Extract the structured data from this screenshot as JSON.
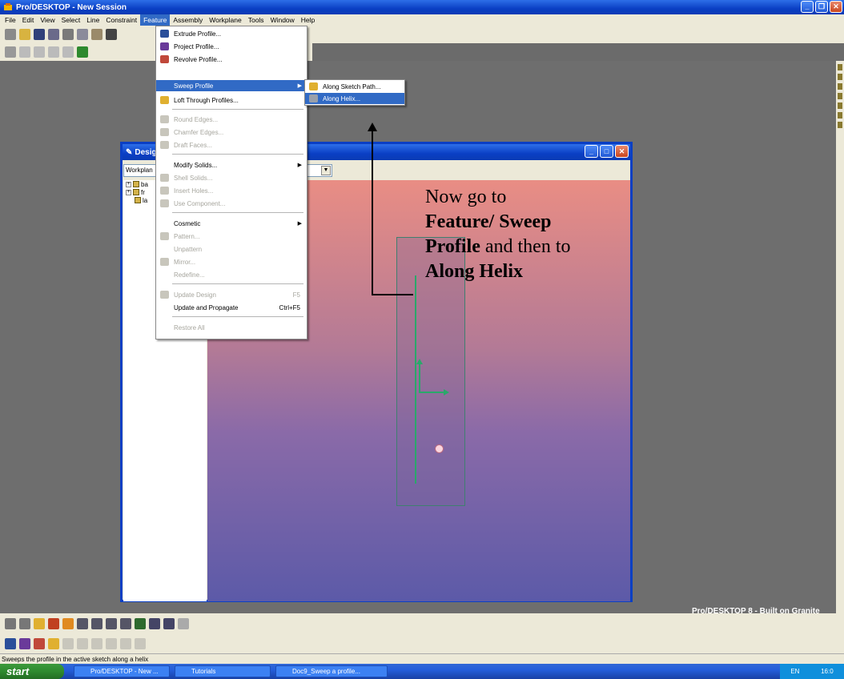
{
  "window": {
    "title": "Pro/DESKTOP - New Session"
  },
  "menubar": [
    "File",
    "Edit",
    "View",
    "Select",
    "Line",
    "Constraint",
    "Feature",
    "Assembly",
    "Workplane",
    "Tools",
    "Window",
    "Help"
  ],
  "feature_menu": {
    "items": [
      {
        "label": "Extrude Profile...",
        "enabled": true
      },
      {
        "label": "Project Profile...",
        "enabled": true
      },
      {
        "label": "Revolve Profile...",
        "enabled": true
      },
      {
        "label": "Sweep Profile",
        "enabled": true,
        "submenu": true,
        "highlighted": true
      },
      {
        "label": "Loft Through Profiles...",
        "enabled": true
      },
      {
        "label": "Round Edges...",
        "enabled": false
      },
      {
        "label": "Chamfer Edges...",
        "enabled": false
      },
      {
        "label": "Draft Faces...",
        "enabled": false
      },
      {
        "label": "Modify Solids...",
        "enabled": true,
        "submenu": true
      },
      {
        "label": "Shell Solids...",
        "enabled": false
      },
      {
        "label": "Insert Holes...",
        "enabled": false
      },
      {
        "label": "Use Component...",
        "enabled": false
      },
      {
        "label": "Cosmetic",
        "enabled": true,
        "submenu": true
      },
      {
        "label": "Pattern...",
        "enabled": false
      },
      {
        "label": "Unpattern",
        "enabled": false
      },
      {
        "label": "Mirror...",
        "enabled": false
      },
      {
        "label": "Redefine...",
        "enabled": false
      },
      {
        "label": "Update Design",
        "enabled": false,
        "shortcut": "F5"
      },
      {
        "label": "Update and Propagate",
        "enabled": true,
        "shortcut": "Ctrl+F5"
      },
      {
        "label": "Restore All",
        "enabled": false
      }
    ]
  },
  "sweep_submenu": {
    "items": [
      {
        "label": "Along Sketch Path...",
        "highlighted": false
      },
      {
        "label": "Along Helix...",
        "highlighted": true
      }
    ]
  },
  "design_window": {
    "title": "Desig",
    "combo_value": "Workplan",
    "tree": [
      {
        "expander": "+",
        "label": "ba"
      },
      {
        "expander": "+",
        "label": "fr"
      },
      {
        "expander": "",
        "label": "la"
      }
    ]
  },
  "annotation": {
    "line1": "Now go to",
    "line2": "Feature/ Sweep",
    "line3": "Profile",
    "line3_suffix": " and then to",
    "line4": "Along Helix"
  },
  "brand": "Pro/DESKTOP 8 - Built on Granite",
  "status_text": "Sweeps the profile in the active sketch along a helix",
  "taskbar": {
    "start": "start",
    "tasks": [
      "Pro/DESKTOP - New ...",
      "Tutorials",
      "Doc9_Sweep a profile..."
    ],
    "tray": {
      "lang": "EN",
      "time": "16:0"
    }
  },
  "colors": {
    "accent": "#316ac5",
    "xp_blue": "#0a3fc4",
    "viewport_top": "#e98d84",
    "viewport_bottom": "#5c5aa8"
  }
}
